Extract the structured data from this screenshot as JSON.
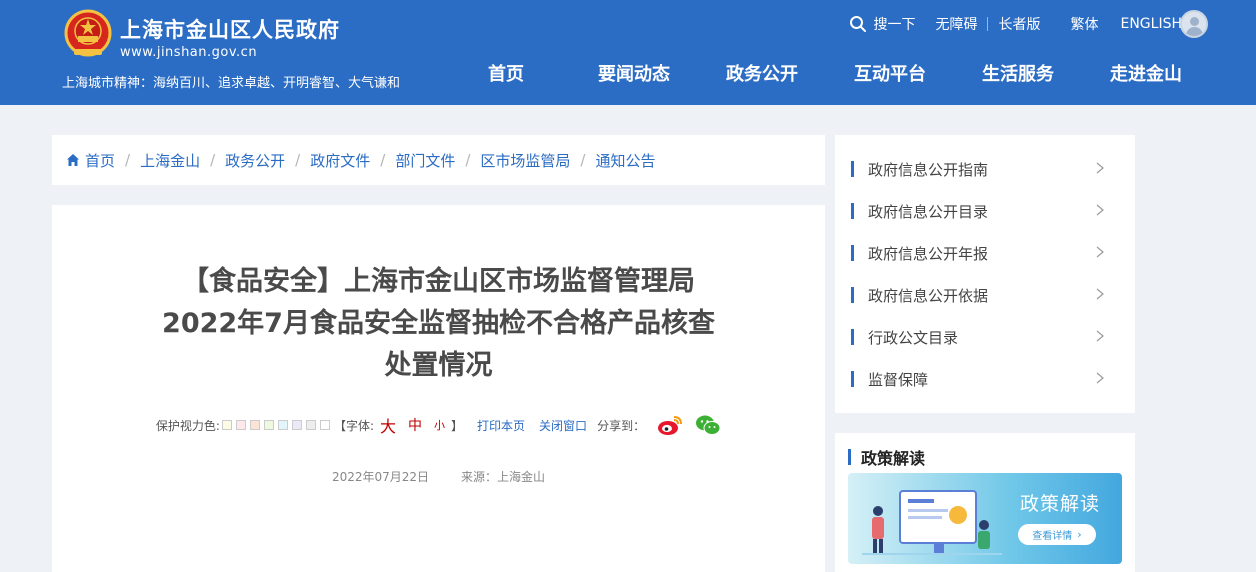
{
  "header": {
    "site_title": "上海市金山区人民政府",
    "domain": "www.jinshan.gov.cn",
    "spirit": "上海城市精神：海纳百川、追求卓越、开明睿智、大气谦和",
    "links": {
      "search": "搜一下",
      "accessibility": "无障碍",
      "elder": "长者版",
      "traditional": "繁体",
      "english": "ENGLISH"
    },
    "nav": [
      "首页",
      "要闻动态",
      "政务公开",
      "互动平台",
      "生活服务",
      "走进金山"
    ]
  },
  "breadcrumb": [
    "首页",
    "上海金山",
    "政务公开",
    "政府文件",
    "部门文件",
    "区市场监管局",
    "通知公告"
  ],
  "article": {
    "title": "【食品安全】上海市金山区市场监督管理局2022年7月食品安全监督抽检不合格产品核查处置情况",
    "tools": {
      "eye_care_label": "保护视力色:",
      "swatch_colors": [
        "#fbfbe6",
        "#fde9e9",
        "#fbe4d6",
        "#eef9df",
        "#e2f5fb",
        "#eaeaf6",
        "#ededed",
        "#ffffff"
      ],
      "font_open": "【字体:",
      "font_big": "大",
      "font_mid": "中",
      "font_small": "小",
      "font_close": "】",
      "print": "打印本页",
      "close": "关闭窗口",
      "share": "分享到："
    },
    "date": "2022年07月22日",
    "source": "来源：上海金山"
  },
  "sidebar": {
    "menu": [
      "政府信息公开指南",
      "政府信息公开目录",
      "政府信息公开年报",
      "政府信息公开依据",
      "行政公文目录",
      "监督保障"
    ],
    "policy_heading": "政策解读",
    "banner_title": "政策解读",
    "banner_button": "查看详情"
  },
  "colors": {
    "header_blue": "#2b6cc4",
    "accent_red": "#c00000",
    "page_bg": "#eef1f6"
  },
  "icons": [
    "national-emblem-icon",
    "search-icon",
    "user-avatar-icon",
    "home-icon",
    "weibo-icon",
    "wechat-icon",
    "chevron-right-icon",
    "arrow-right-icon"
  ]
}
